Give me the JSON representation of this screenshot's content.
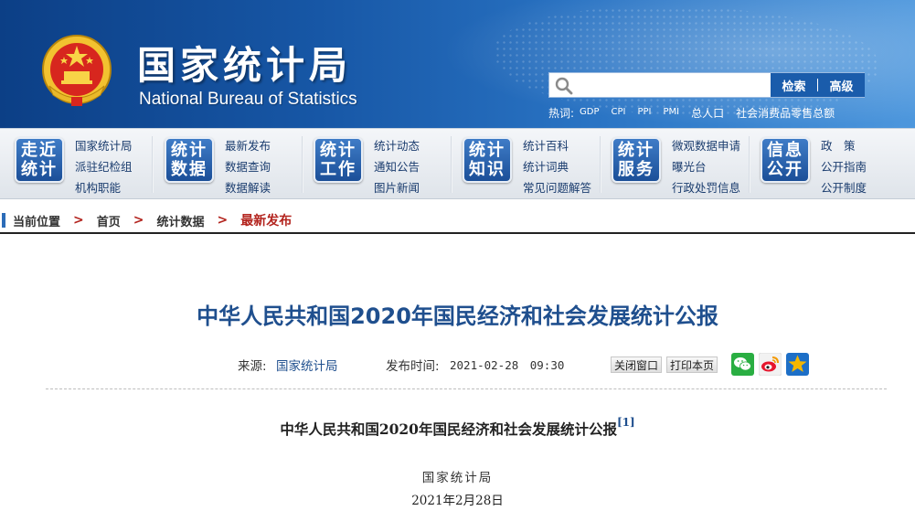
{
  "header": {
    "title_cn": "国家统计局",
    "title_en": "National Bureau of Statistics",
    "search": {
      "placeholder": "",
      "value": "",
      "search_label": "检索",
      "advanced_label": "高级"
    },
    "hot_label": "热词:",
    "hot_words": [
      "GDP",
      "CPI",
      "PPI",
      "PMI",
      "总人口",
      "社会消费品零售总额"
    ]
  },
  "nav": [
    {
      "tile": [
        "走近",
        "统计"
      ],
      "links": [
        "国家统计局",
        "派驻纪检组",
        "机构职能"
      ]
    },
    {
      "tile": [
        "统计",
        "数据"
      ],
      "links": [
        "最新发布",
        "数据查询",
        "数据解读"
      ]
    },
    {
      "tile": [
        "统计",
        "工作"
      ],
      "links": [
        "统计动态",
        "通知公告",
        "图片新闻"
      ]
    },
    {
      "tile": [
        "统计",
        "知识"
      ],
      "links": [
        "统计百科",
        "统计词典",
        "常见问题解答"
      ]
    },
    {
      "tile": [
        "统计",
        "服务"
      ],
      "links": [
        "微观数据申请",
        "曝光台",
        "行政处罚信息"
      ]
    },
    {
      "tile": [
        "信息",
        "公开"
      ],
      "links": [
        "政　策",
        "公开指南",
        "公开制度"
      ]
    }
  ],
  "breadcrumb": {
    "items": [
      "当前位置",
      "首页",
      "统计数据",
      "最新发布"
    ],
    "separator": ">"
  },
  "article": {
    "title": "中华人民共和国2020年国民经济和社会发展统计公报",
    "source_label": "来源:",
    "source": "国家统计局",
    "date_label": "发布时间:",
    "date": "2021-02-28　09:30",
    "close_label": "关闭窗口",
    "print_label": "打印本页",
    "share_icons": [
      "wechat-icon",
      "weibo-icon",
      "qzone-icon"
    ],
    "doc_heading": "中华人民共和国2020年国民经济和社会发展统计公报",
    "doc_footnote": "[1]",
    "author": "国家统计局",
    "doc_date": "2021年2月28日"
  },
  "colors": {
    "banner": "#1757a6",
    "title_blue": "#1f4f8e",
    "breadcrumb_red": "#b3241e",
    "wechat": "#2aae42",
    "weibo": "#e6162d",
    "qzone": "#f5b700"
  }
}
